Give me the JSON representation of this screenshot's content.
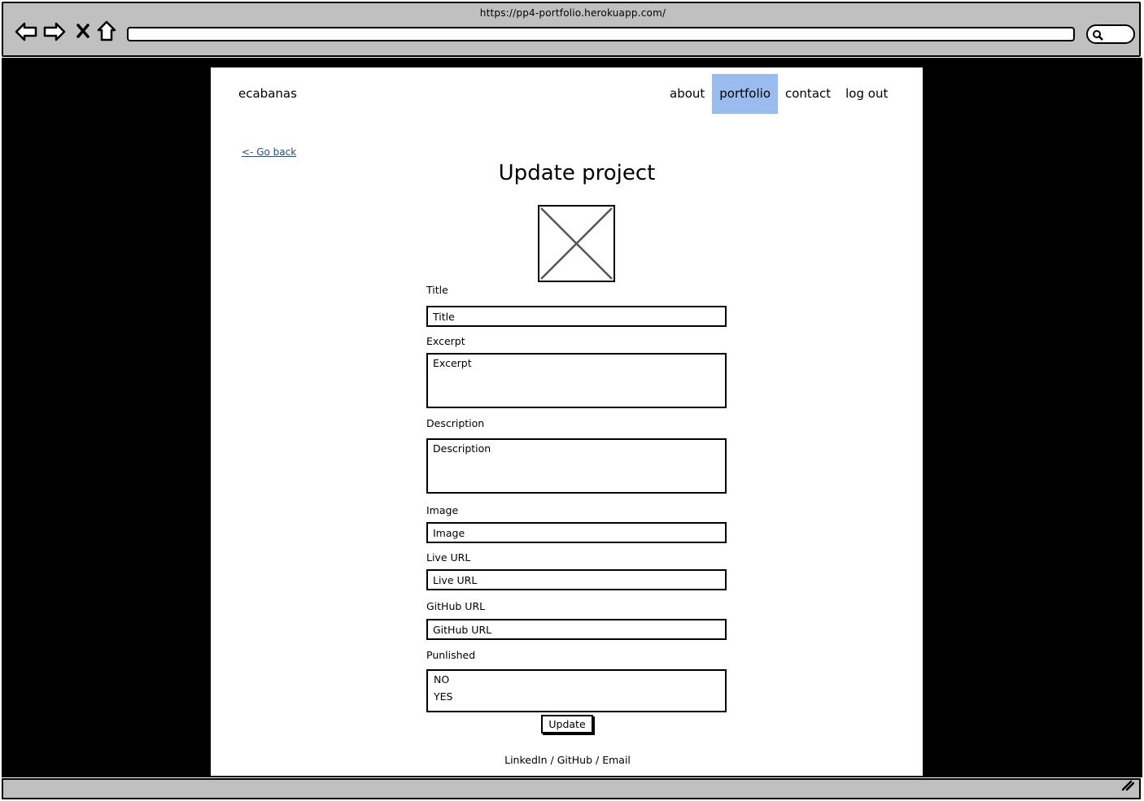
{
  "browser": {
    "url": "https://pp4-portfolio.herokuapp.com/",
    "icons": [
      "back-arrow-icon",
      "forward-arrow-icon",
      "close-icon",
      "home-icon",
      "search-icon",
      "resize-grip-icon"
    ]
  },
  "header": {
    "brand": "ecabanas",
    "nav": [
      {
        "label": "about",
        "active": false
      },
      {
        "label": "portfolio",
        "active": true
      },
      {
        "label": "contact",
        "active": false
      },
      {
        "label": "log out",
        "active": false
      }
    ],
    "accent_color": "#99bbee"
  },
  "main": {
    "back_link": "<- Go back",
    "title": "Update project",
    "form": {
      "title": {
        "label": "Title",
        "placeholder": "Title"
      },
      "excerpt": {
        "label": "Excerpt",
        "placeholder": "Excerpt"
      },
      "description": {
        "label": "Description",
        "placeholder": "Description"
      },
      "image": {
        "label": "Image",
        "placeholder": "Image"
      },
      "live_url": {
        "label": "Live URL",
        "placeholder": "Live URL"
      },
      "github_url": {
        "label": "GitHub URL",
        "placeholder": "GitHub URL"
      },
      "published": {
        "label": "Punlished",
        "options": [
          "NO",
          "YES"
        ]
      },
      "submit_label": "Update"
    }
  },
  "footer": {
    "linkedin": "LinkedIn",
    "github": "GitHub",
    "email": "Email",
    "separator": "/"
  }
}
